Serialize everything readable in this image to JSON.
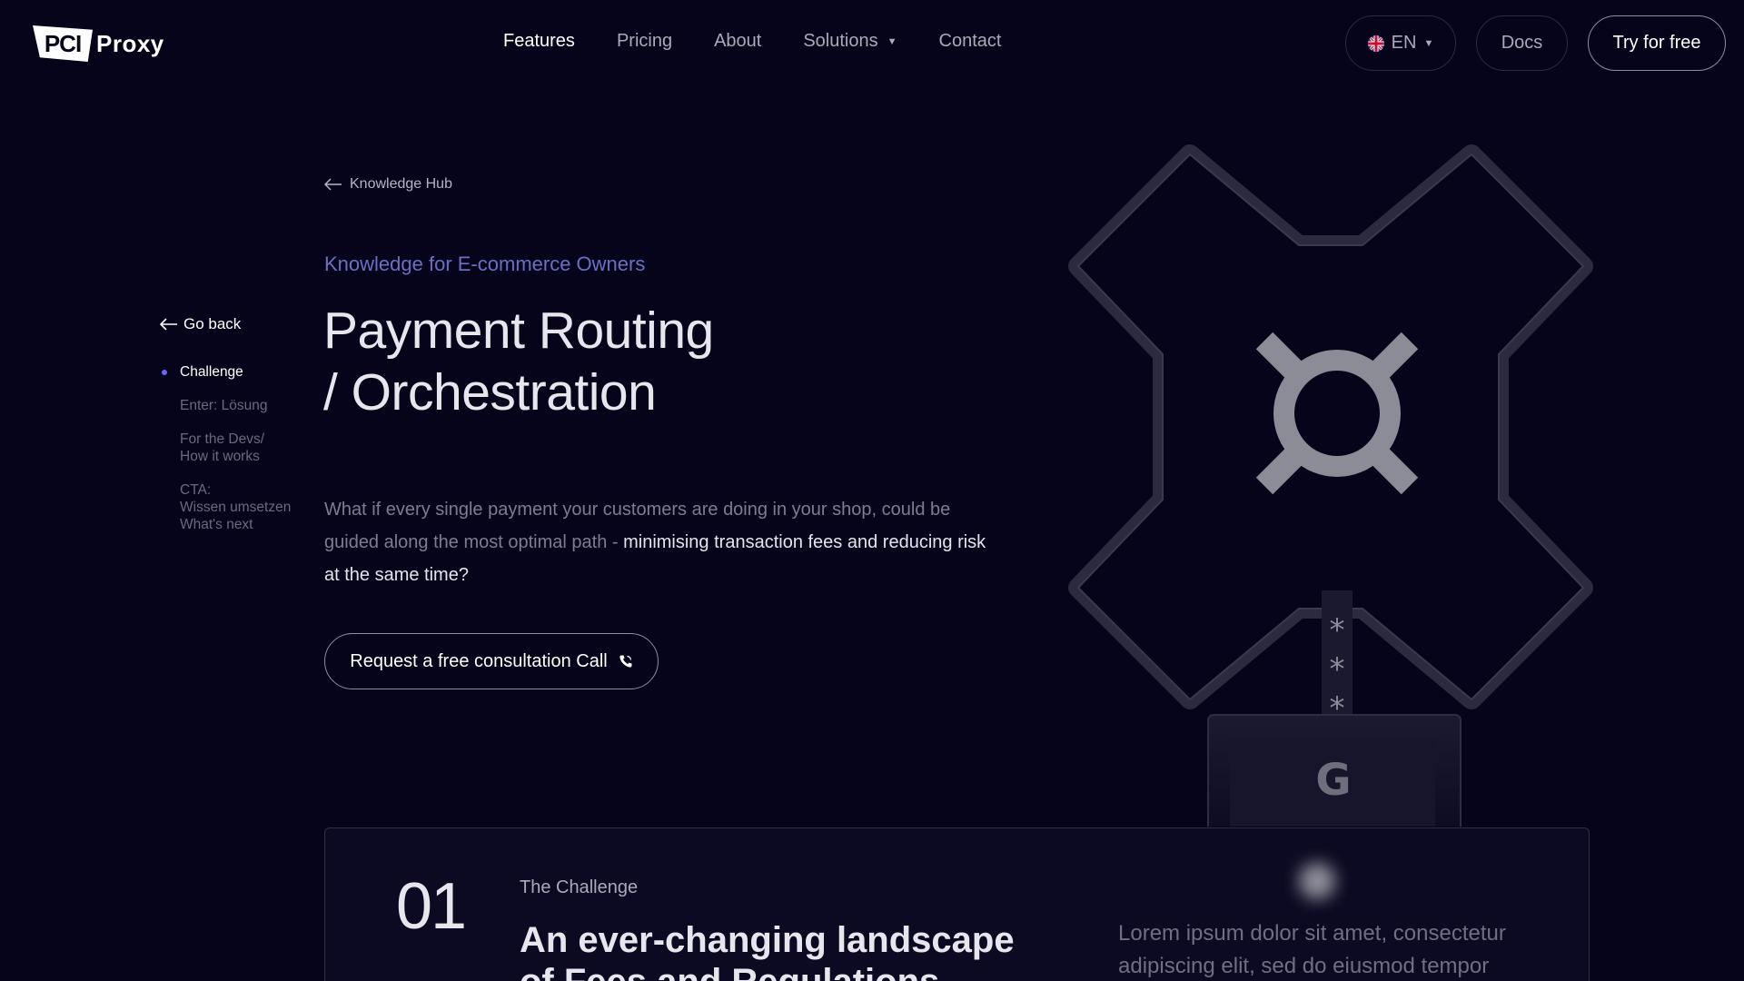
{
  "header": {
    "logo_badge": "PCI",
    "logo_text": "Proxy",
    "nav": [
      {
        "label": "Features",
        "active": true
      },
      {
        "label": "Pricing"
      },
      {
        "label": "About"
      },
      {
        "label": "Solutions",
        "has_dropdown": true
      },
      {
        "label": "Contact"
      }
    ],
    "language": "EN",
    "docs_label": "Docs",
    "try_label": "Try for free"
  },
  "sidebar": {
    "go_back": "Go back",
    "toc": [
      {
        "label": "Challenge",
        "active": true
      },
      {
        "label": "Enter: Lösung"
      },
      {
        "label": "For the Devs/\nHow it works"
      },
      {
        "label": "CTA:\nWissen umsetzen\nWhat's next"
      }
    ]
  },
  "main": {
    "breadcrumb": "Knowledge Hub",
    "eyebrow": "Knowledge for E-commerce Owners",
    "title_line1": "Payment Routing",
    "title_line2": "/ Orchestration",
    "lead_plain": "What if every single payment your customers are doing in your shop, could be guided along the most optimal path - ",
    "lead_highlight": "minimising transaction fees and reducing risk at the same time?",
    "cta_label": "Request a free consultation Call"
  },
  "illustration": {
    "asterisks": [
      "*",
      "*",
      "*"
    ],
    "tile_letter": "G"
  },
  "challenge": {
    "number": "01",
    "eyebrow": "The Challenge",
    "title": "An ever-changing landscape of Fees and Regulations",
    "text": "Lorem ipsum dolor sit amet, consectetur adipiscing elit, sed do eiusmod tempor"
  },
  "colors": {
    "background": "#05041a",
    "accent": "#6b68ff",
    "eyebrow": "#6b6fc4"
  }
}
